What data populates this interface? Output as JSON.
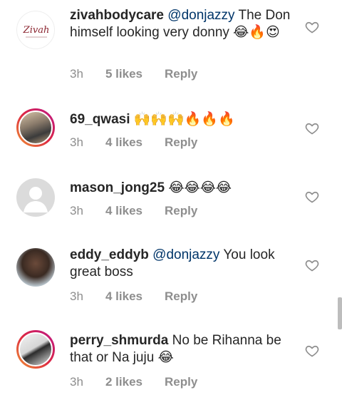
{
  "comments": [
    {
      "username": "zivahbodycare",
      "mention": "@donjazzy",
      "text": " The Don himself  looking very donny 😂🔥😍",
      "time": "3h",
      "likes": "5 likes",
      "reply": "Reply",
      "avatar": "zivah-logo"
    },
    {
      "username": "69_qwasi",
      "mention": "",
      "text": " 🙌🙌🙌🔥🔥🔥",
      "time": "3h",
      "likes": "4 likes",
      "reply": "Reply",
      "avatar": "photo"
    },
    {
      "username": "mason_jong25",
      "mention": "",
      "text": " 😂😂😂😂",
      "time": "3h",
      "likes": "4 likes",
      "reply": "Reply",
      "avatar": "default"
    },
    {
      "username": "eddy_eddyb",
      "mention": "@donjazzy",
      "text": " You look great boss",
      "time": "3h",
      "likes": "4 likes",
      "reply": "Reply",
      "avatar": "photo"
    },
    {
      "username": "perry_shmurda",
      "mention": "",
      "text": " No be Rihanna be that or Na juju 😂",
      "time": "3h",
      "likes": "2 likes",
      "reply": "Reply",
      "avatar": "photo"
    }
  ],
  "logo_text": "Zivah",
  "colors": {
    "text": "#262626",
    "meta": "#8e8e8e",
    "mention": "#003569",
    "heart": "#8e8e8e"
  },
  "icons": [
    "heart-outline-icon"
  ]
}
